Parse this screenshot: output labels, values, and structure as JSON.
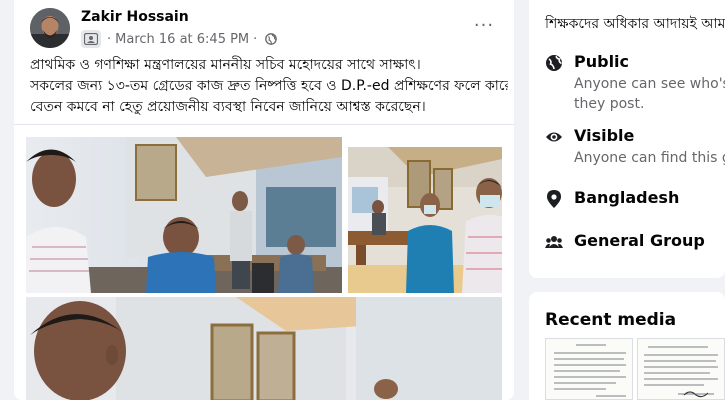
{
  "post": {
    "author": "Zakir Hossain",
    "date": "March 16 at 6:45 PM",
    "separator": "·",
    "more": "···",
    "text_lines": [
      "প্রাথমিক ও গণশিক্ষা মন্ত্রণালয়ের মাননীয় সচিব মহোদয়ের সাথে সাক্ষাৎ।",
      " সকলের জন্য ১৩-তম গ্রেডের কাজ দ্রুত নিষ্পত্তি হবে ও D.P.-ed প্রশিক্ষণের ফলে কারো",
      "বেতন কমবে না হেতু প্রয়োজনীয় ব্যবস্থা নিবেন জানিয়ে আশ্বস্ত করেছেন।"
    ]
  },
  "sidebar": {
    "about_description": "শিক্ষকদের অধিকার আদায়ই আমা",
    "items": [
      {
        "icon": "globe-icon",
        "title": "Public",
        "desc": [
          "Anyone can see who's i",
          "they post."
        ]
      },
      {
        "icon": "eye-icon",
        "title": "Visible",
        "desc": [
          "Anyone can find this gr"
        ]
      },
      {
        "icon": "location-pin-icon",
        "title": "Bangladesh",
        "desc": []
      },
      {
        "icon": "group-icon",
        "title": "General Group",
        "desc": []
      }
    ],
    "recent_media_title": "Recent media"
  },
  "colors": {
    "primary_text": "#050505",
    "secondary_text": "#65676b",
    "page_bg": "#f0f2f5",
    "card_bg": "#ffffff"
  }
}
